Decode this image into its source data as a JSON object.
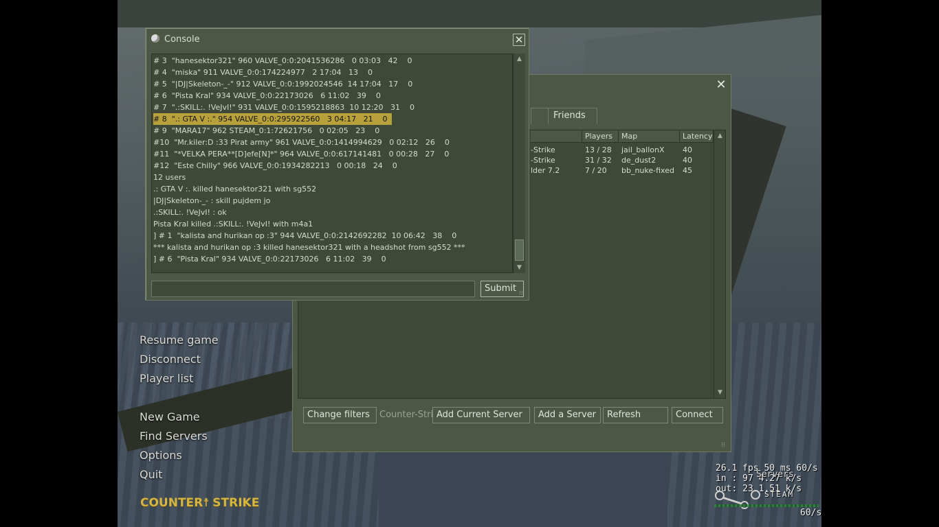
{
  "console": {
    "title": "Console",
    "close": "✕",
    "lines": [
      "# 3  \"hanesektor321\" 960 VALVE_0:0:2041536286   0 03:03   42    0",
      "# 4  \"miska\" 911 VALVE_0:0:174224977   2 17:04   13    0",
      "# 5  \"|DJ|Skeleton-_-\" 912 VALVE_0:0:1992024546  14 17:04   17    0",
      "# 6  \"Pista Kral\" 934 VALVE_0:0:22173026   6 11:02   39    0",
      "# 7  \".:SKILL:. !VeJvI!\" 931 VALVE_0:0:1595218863  10 12:20   31    0",
      "# 8  \".: GTA V :.\" 954 VALVE_0:0:295922560   3 04:17   21    0",
      "# 9  \"MARA17\" 962 STEAM_0:1:72621756   0 02:05   23    0",
      "#10  \"Mr.kiler:D :33 Pirat army\" 961 VALVE_0:0:1414994629   0 02:12   26    0",
      "#11  \"*VELKA PERA**[D]efe[N]*\" 964 VALVE_0:0:617141481   0 00:28   27    0",
      "#12  \"Este Chilly\" 966 VALVE_0:0:1934282213   0 00:18   24    0",
      "12 users",
      ".: GTA V :. killed hanesektor321 with sg552",
      "|DJ|Skeleton-_- : skill pujdem jo",
      ".:SKILL:. !VeJvI! : ok",
      "Pista Kral killed .:SKILL:. !VeJvI! with m4a1",
      "] # 1  \"kalista and hurikan op :3\" 944 VALVE_0:0:2142692282  10 06:42   38    0",
      "*** kalista and hurikan op :3 killed hanesektor321 with a headshot from sg552 ***",
      "] # 6  \"Pista Kral\" 934 VALVE_0:0:22173026   6 11:02   39    0"
    ],
    "highlighted_line_index": 5,
    "input_value": "",
    "submit_label": "Submit"
  },
  "servers": {
    "close": "✕",
    "tabs": {
      "friends": "Friends"
    },
    "columns": {
      "players": "Players",
      "map": "Map",
      "latency": "Latency"
    },
    "rows": [
      {
        "name": "-Strike",
        "players": "13 / 28",
        "map": "jail_ballonX",
        "latency": "40"
      },
      {
        "name": "-Strike",
        "players": "31 / 32",
        "map": "de_dust2",
        "latency": "40"
      },
      {
        "name": "lder 7.2",
        "players": "7 / 20",
        "map": "bb_nuke-fixed",
        "latency": "45"
      }
    ],
    "buttons": {
      "change_filters": "Change filters",
      "filter_label": "Counter-Stri...",
      "add_current": "Add Current Server",
      "add_server": "Add a Server",
      "refresh": "Refresh",
      "connect": "Connect"
    }
  },
  "menu": {
    "resume": "Resume game",
    "disconnect": "Disconnect",
    "player_list": "Player list",
    "new_game": "New Game",
    "find_servers": "Find Servers",
    "options": "Options",
    "quit": "Quit"
  },
  "logo": {
    "text_a": "COUNTER",
    "text_b": "STRIKE"
  },
  "netgraph": {
    "fps": "26.1 fps  50 ms 60/s",
    "in": "in :  97 4.27 k/s",
    "out": "out:  23 1.51 k/s",
    "servers_overlay": "Servers",
    "steam": "STEAM",
    "rate": "60/s"
  },
  "colors": {
    "panel": "#4c5844",
    "panel_dark": "#3e4a37",
    "highlight": "#b8a13b",
    "logo": "#d7b640"
  }
}
